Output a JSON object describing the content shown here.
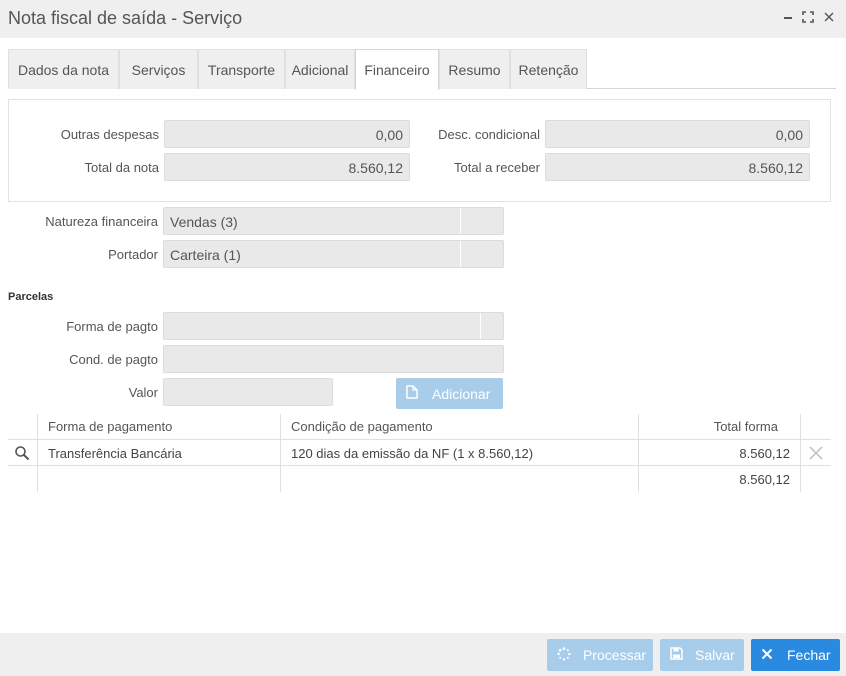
{
  "window": {
    "title": "Nota fiscal de saída - Serviço",
    "minimize_icon": "minimize-icon",
    "maximize_icon": "maximize-icon",
    "close_icon": "close-icon"
  },
  "tabs": [
    {
      "label": "Dados da nota"
    },
    {
      "label": "Serviços"
    },
    {
      "label": "Transporte"
    },
    {
      "label": "Adicional"
    },
    {
      "label": "Financeiro",
      "active": true
    },
    {
      "label": "Resumo"
    },
    {
      "label": "Retenção"
    }
  ],
  "totals": {
    "outras_despesas": {
      "label": "Outras despesas",
      "value": "0,00"
    },
    "desc_condicional": {
      "label": "Desc. condicional",
      "value": "0,00"
    },
    "total_nota": {
      "label": "Total da nota",
      "value": "8.560,12"
    },
    "total_receber": {
      "label": "Total a receber",
      "value": "8.560,12"
    }
  },
  "financeiro": {
    "natureza": {
      "label": "Natureza financeira",
      "value": "Vendas (3)"
    },
    "portador": {
      "label": "Portador",
      "value": "Carteira (1)"
    }
  },
  "parcelas": {
    "title": "Parcelas",
    "forma_label": "Forma de pagto",
    "forma_value": "",
    "cond_label": "Cond. de pagto",
    "cond_value": "",
    "valor_label": "Valor",
    "valor_value": "",
    "add_button": "Adicionar"
  },
  "grid": {
    "columns": [
      "Forma de pagamento",
      "Condição de pagamento",
      "Total forma"
    ],
    "rows": [
      {
        "forma": "Transferência Bancária",
        "condicao": "120 dias da emissão da NF (1 x 8.560,12)",
        "total": "8.560,12"
      }
    ],
    "summary_total": "8.560,12"
  },
  "footer": {
    "processar": "Processar",
    "salvar": "Salvar",
    "fechar": "Fechar"
  },
  "colors": {
    "accent": "#2a8ae0",
    "disabled_button": "#a8cdeb",
    "field_bg": "#e9e9e9"
  }
}
